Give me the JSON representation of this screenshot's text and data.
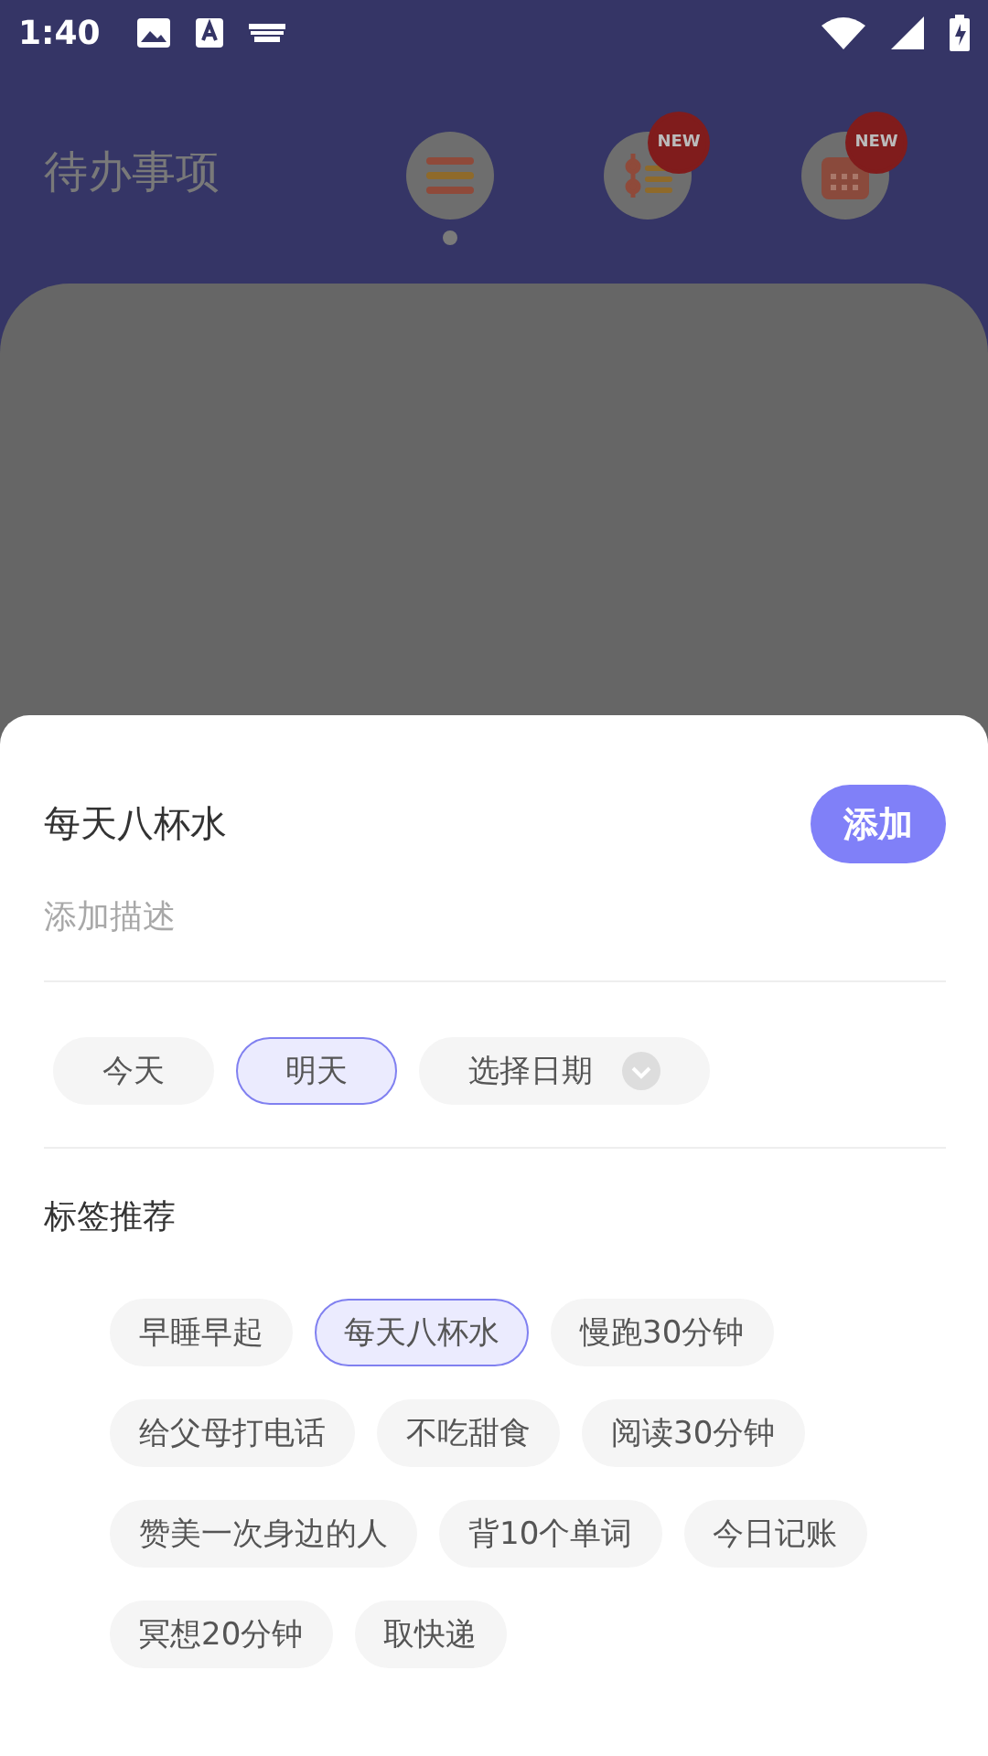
{
  "status_bar": {
    "time": "1:40"
  },
  "header": {
    "title": "待办事项",
    "nav": [
      {
        "kind": "list",
        "selected": true
      },
      {
        "kind": "timeline",
        "selected": false,
        "badge": "NEW"
      },
      {
        "kind": "calendar",
        "selected": false,
        "badge": "NEW"
      }
    ]
  },
  "sheet": {
    "task_title": "每天八杯水",
    "add_button": "添加",
    "description_placeholder": "添加描述",
    "dates": [
      {
        "label": "今天",
        "selected": false,
        "kind": "chip"
      },
      {
        "label": "明天",
        "selected": true,
        "kind": "chip"
      },
      {
        "label": "选择日期",
        "selected": false,
        "kind": "dropdown"
      }
    ],
    "tags_title": "标签推荐",
    "tags": [
      {
        "label": "早睡早起",
        "selected": false
      },
      {
        "label": "每天八杯水",
        "selected": true
      },
      {
        "label": "慢跑30分钟",
        "selected": false
      },
      {
        "label": "给父母打电话",
        "selected": false
      },
      {
        "label": "不吃甜食",
        "selected": false
      },
      {
        "label": "阅读30分钟",
        "selected": false
      },
      {
        "label": "赞美一次身边的人",
        "selected": false
      },
      {
        "label": "背10个单词",
        "selected": false
      },
      {
        "label": "今日记账",
        "selected": false
      },
      {
        "label": "冥想20分钟",
        "selected": false
      },
      {
        "label": "取快递",
        "selected": false
      }
    ]
  }
}
